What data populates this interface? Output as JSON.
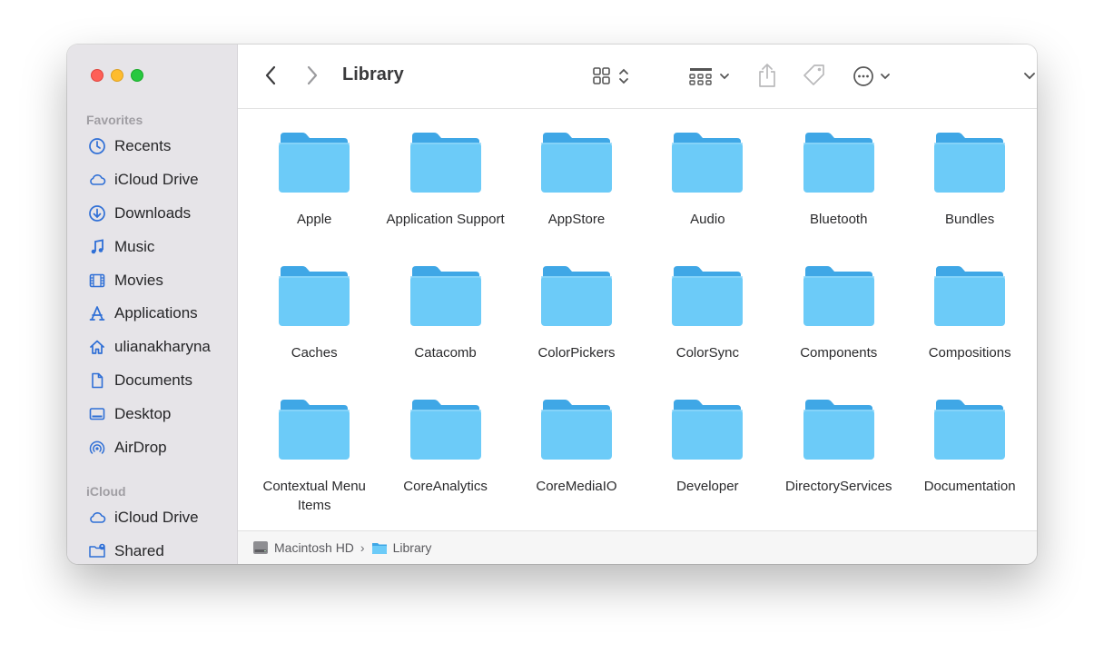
{
  "window": {
    "title": "Library"
  },
  "sidebar": {
    "favorites_label": "Favorites",
    "favorites": [
      {
        "label": "Recents",
        "icon": "clock-icon"
      },
      {
        "label": "iCloud Drive",
        "icon": "cloud-icon"
      },
      {
        "label": "Downloads",
        "icon": "download-icon"
      },
      {
        "label": "Music",
        "icon": "music-icon"
      },
      {
        "label": "Movies",
        "icon": "film-icon"
      },
      {
        "label": "Applications",
        "icon": "applications-icon"
      },
      {
        "label": "ulianakharyna",
        "icon": "home-icon"
      },
      {
        "label": "Documents",
        "icon": "document-icon"
      },
      {
        "label": "Desktop",
        "icon": "desktop-icon"
      },
      {
        "label": "AirDrop",
        "icon": "airdrop-icon"
      }
    ],
    "icloud_label": "iCloud",
    "icloud": [
      {
        "label": "iCloud Drive",
        "icon": "cloud-icon"
      },
      {
        "label": "Shared",
        "icon": "shared-folder-icon"
      }
    ]
  },
  "toolbar": {
    "back": "back-icon",
    "forward": "forward-icon",
    "view": "grid-view-icon",
    "group": "group-icon",
    "share": "share-icon",
    "tag": "tag-icon",
    "more": "more-icon",
    "search": "search-icon"
  },
  "folders": [
    "Apple",
    "Application Support",
    "AppStore",
    "Audio",
    "Bluetooth",
    "Bundles",
    "Caches",
    "Catacomb",
    "ColorPickers",
    "ColorSync",
    "Components",
    "Compositions",
    "Contextual Menu Items",
    "CoreAnalytics",
    "CoreMediaIO",
    "Developer",
    "DirectoryServices",
    "Documentation"
  ],
  "pathbar": {
    "disk": "Macintosh HD",
    "folder": "Library"
  },
  "colors": {
    "folder_body": "#6ccbf8",
    "folder_tab": "#3fa7e6",
    "sidebar_icon": "#2f6fd6",
    "sidebar_bg": "#e6e4e8"
  }
}
